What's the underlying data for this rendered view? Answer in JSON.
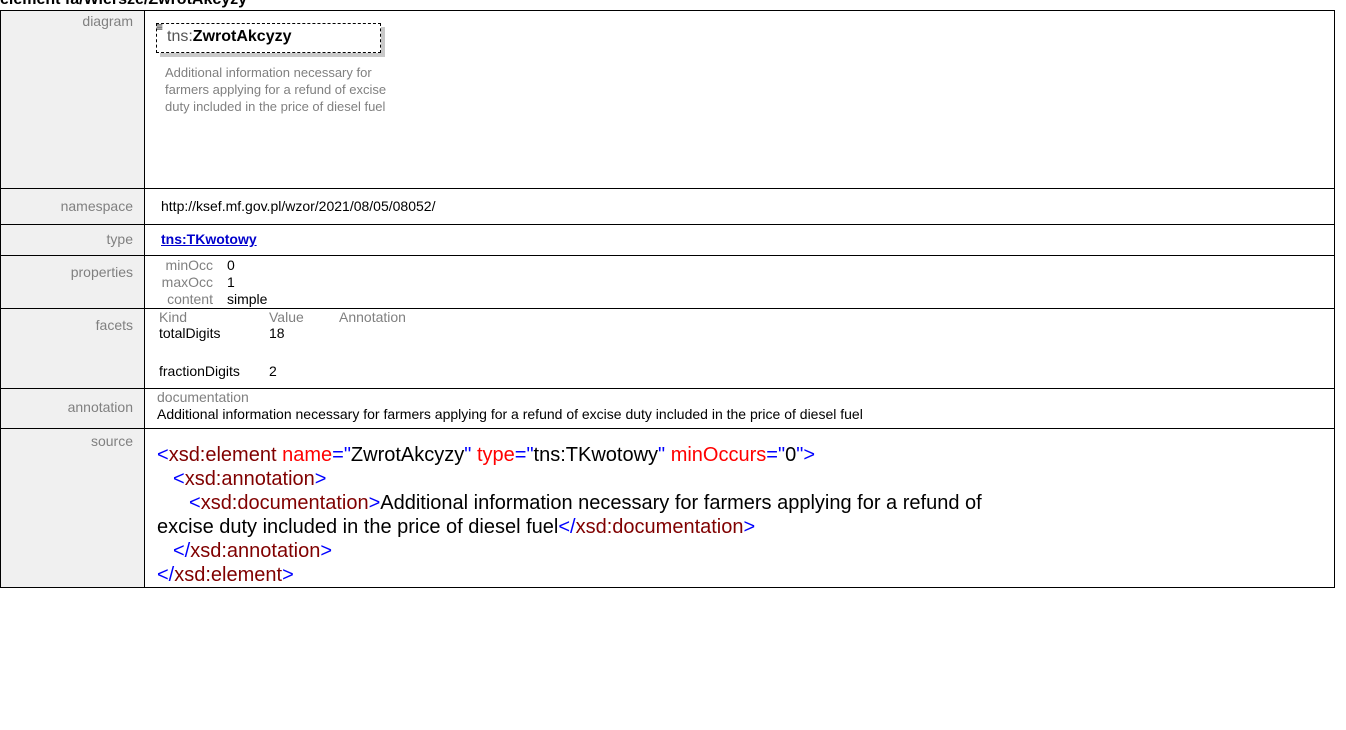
{
  "page": {
    "title": "element fa/Wiersze/ZwrotAkcyzy"
  },
  "labels": {
    "diagram": "diagram",
    "namespace": "namespace",
    "type": "type",
    "properties": "properties",
    "facets": "facets",
    "annotation": "annotation",
    "source": "source"
  },
  "diagram": {
    "icon": "≡",
    "prefix": "tns:",
    "name": "ZwrotAkcyzy",
    "documentation": "Additional information necessary for farmers applying for a refund of excise duty included in the price of diesel fuel"
  },
  "namespace": "http://ksef.mf.gov.pl/wzor/2021/08/05/08052/",
  "type": "tns:TKwotowy",
  "properties": [
    {
      "key": "minOcc",
      "value": "0"
    },
    {
      "key": "maxOcc",
      "value": "1"
    },
    {
      "key": "content",
      "value": "simple"
    }
  ],
  "facets": {
    "headers": [
      "Kind",
      "Value",
      "Annotation"
    ],
    "rows": [
      {
        "kind": "totalDigits",
        "value": "18",
        "annotation": ""
      },
      {
        "kind": "fractionDigits",
        "value": "2",
        "annotation": ""
      }
    ]
  },
  "annotation": {
    "header": "documentation",
    "text": "Additional information necessary for farmers applying for a refund of excise duty included in the price of diesel fuel"
  },
  "source": {
    "open_tag": "<",
    "close_tag": ">",
    "end_open": "</",
    "q": "\"",
    "eq": "=",
    "el_element": "xsd:element",
    "attr_name": "name",
    "val_name": "ZwrotAkcyzy",
    "attr_type": "type",
    "val_type": "tns:TKwotowy",
    "attr_min": "minOccurs",
    "val_min": "0",
    "el_annotation": "xsd:annotation",
    "el_documentation": "xsd:documentation",
    "doc_text_1": "Additional information necessary for farmers applying for a refund of",
    "doc_text_2": "excise duty included in the price of diesel fuel"
  },
  "colors": {
    "label_bg": "#f0f0f0",
    "label_fg": "#808080",
    "link": "#0000cc",
    "xml_tag": "#0000ff",
    "xml_element": "#800000",
    "xml_attr": "#ff0000"
  }
}
